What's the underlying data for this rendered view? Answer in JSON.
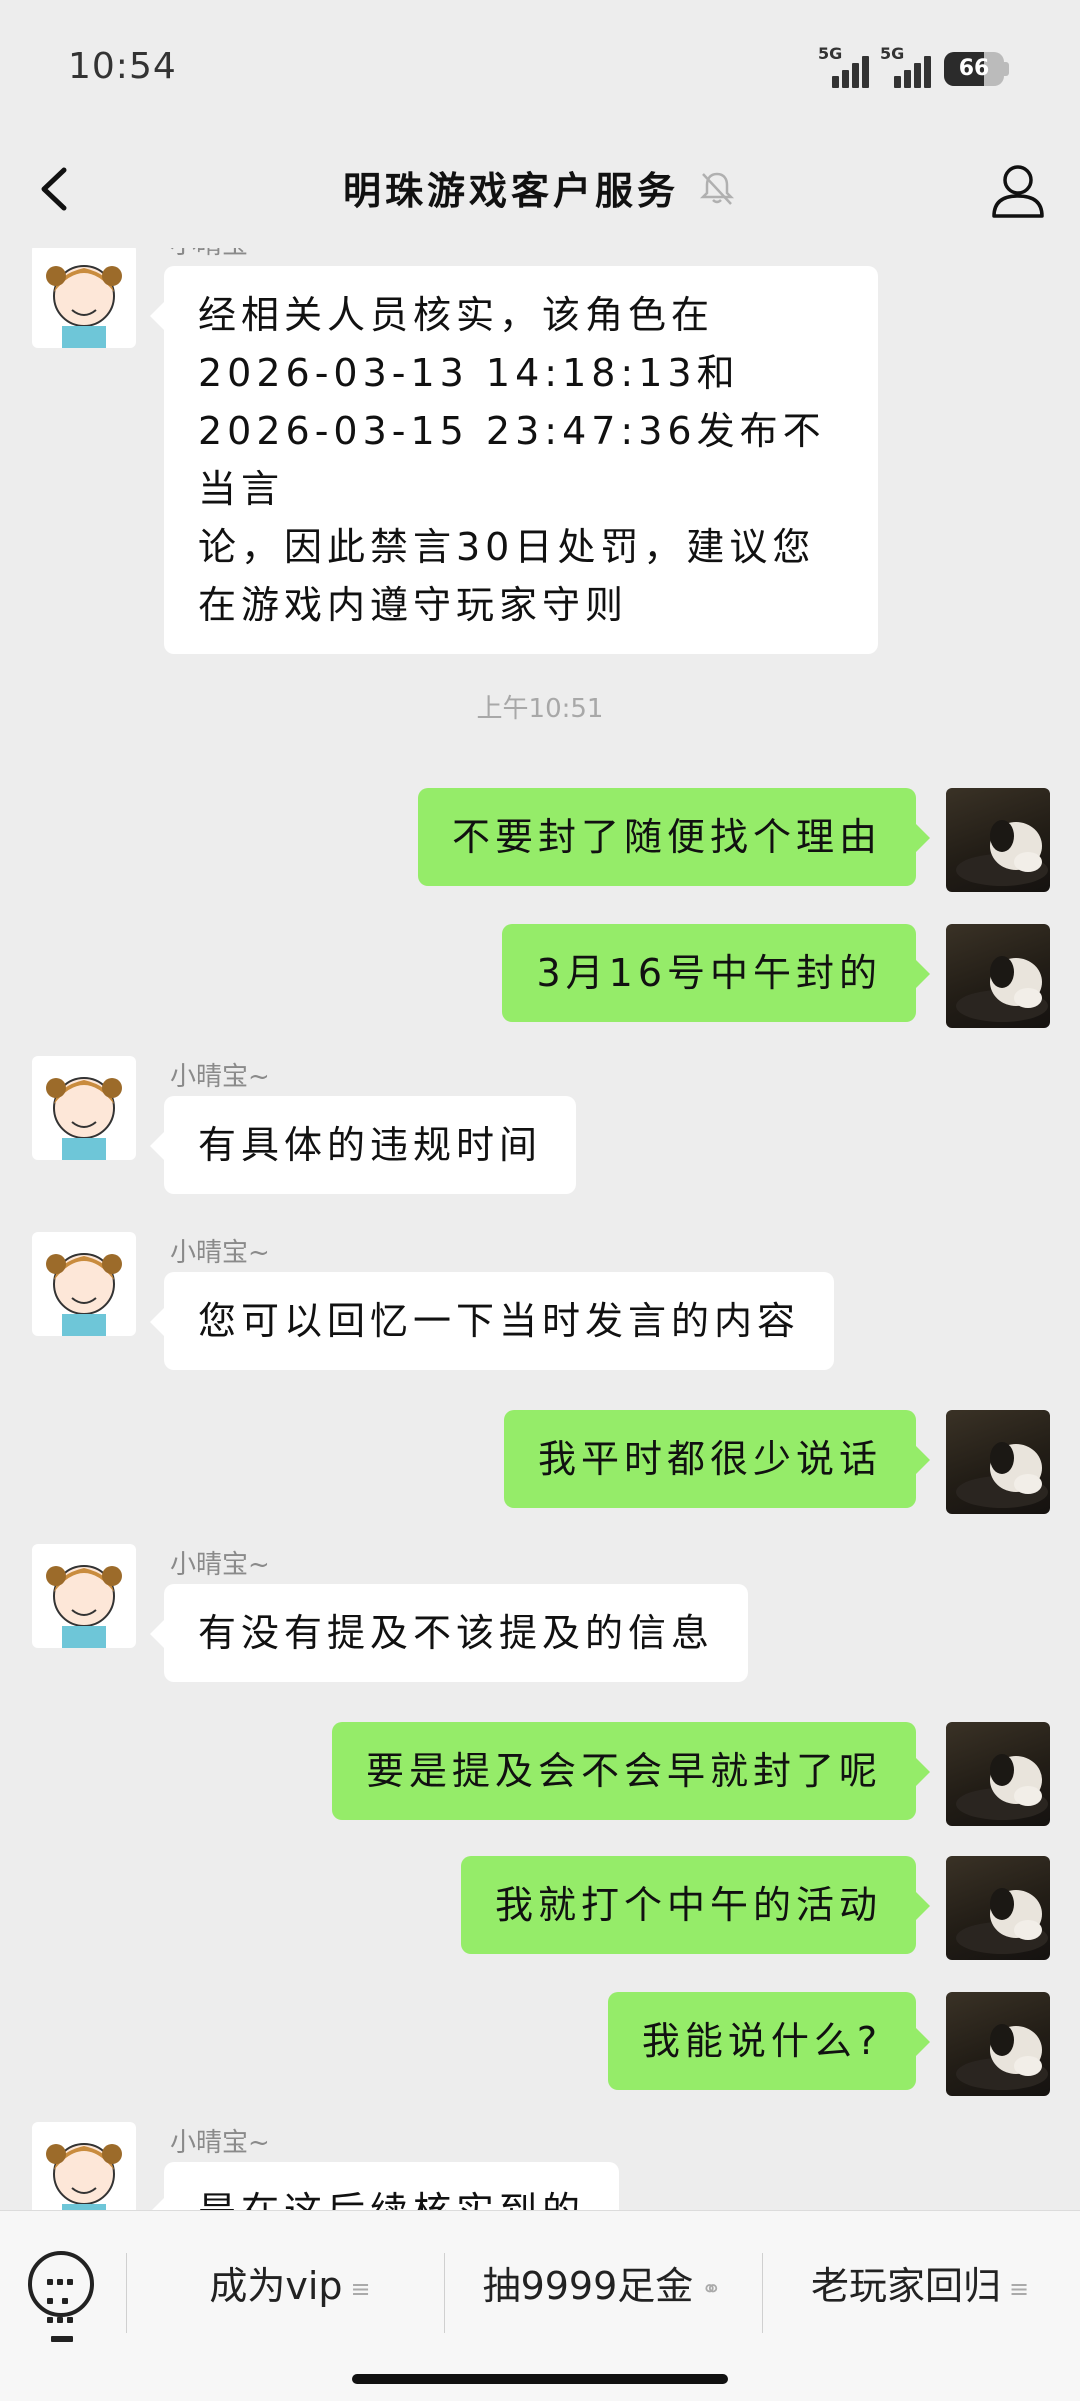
{
  "status_bar": {
    "time": "10:54",
    "signal_label_1": "5G",
    "signal_label_2": "5G",
    "battery": "66"
  },
  "header": {
    "title": "明珠游戏客户服务",
    "mute_icon": "bell-off-icon",
    "back_icon": "chevron-left-icon",
    "profile_icon": "person-icon"
  },
  "messages": [
    {
      "sender": "小晴宝~",
      "lines": [
        "经相关人员核实，该角色在",
        "2026-03-13 14:18:13和",
        "2026-03-15 23:47:36发布不当言",
        "论，因此禁言30日处罚，建议您",
        "在游戏内遵守玩家守则"
      ]
    },
    {
      "timestamp": "上午10:51"
    },
    {
      "text": "不要封了随便找个理由"
    },
    {
      "text": "3月16号中午封的"
    },
    {
      "sender": "小晴宝~",
      "text": "有具体的违规时间"
    },
    {
      "sender": "小晴宝~",
      "text": "您可以回忆一下当时发言的内容"
    },
    {
      "text": "我平时都很少说话"
    },
    {
      "sender": "小晴宝~",
      "text": "有没有提及不该提及的信息"
    },
    {
      "text": "要是提及会不会早就封了呢"
    },
    {
      "text": "我就打个中午的活动"
    },
    {
      "text": "我能说什么?"
    },
    {
      "sender": "小晴宝~",
      "text": "是在这后续核实到的"
    }
  ],
  "bottom_menu": {
    "items": [
      {
        "label": "成为vip",
        "icon": "menu-icon",
        "icon_glyph": "≡"
      },
      {
        "label": "抽9999足金",
        "icon": "link-icon",
        "icon_glyph": "⚭"
      },
      {
        "label": "老玩家回归",
        "icon": "menu-icon",
        "icon_glyph": "≡"
      }
    ]
  },
  "colors": {
    "background": "#ededed",
    "sent_bubble": "#95ec69",
    "received_bubble": "#ffffff"
  }
}
